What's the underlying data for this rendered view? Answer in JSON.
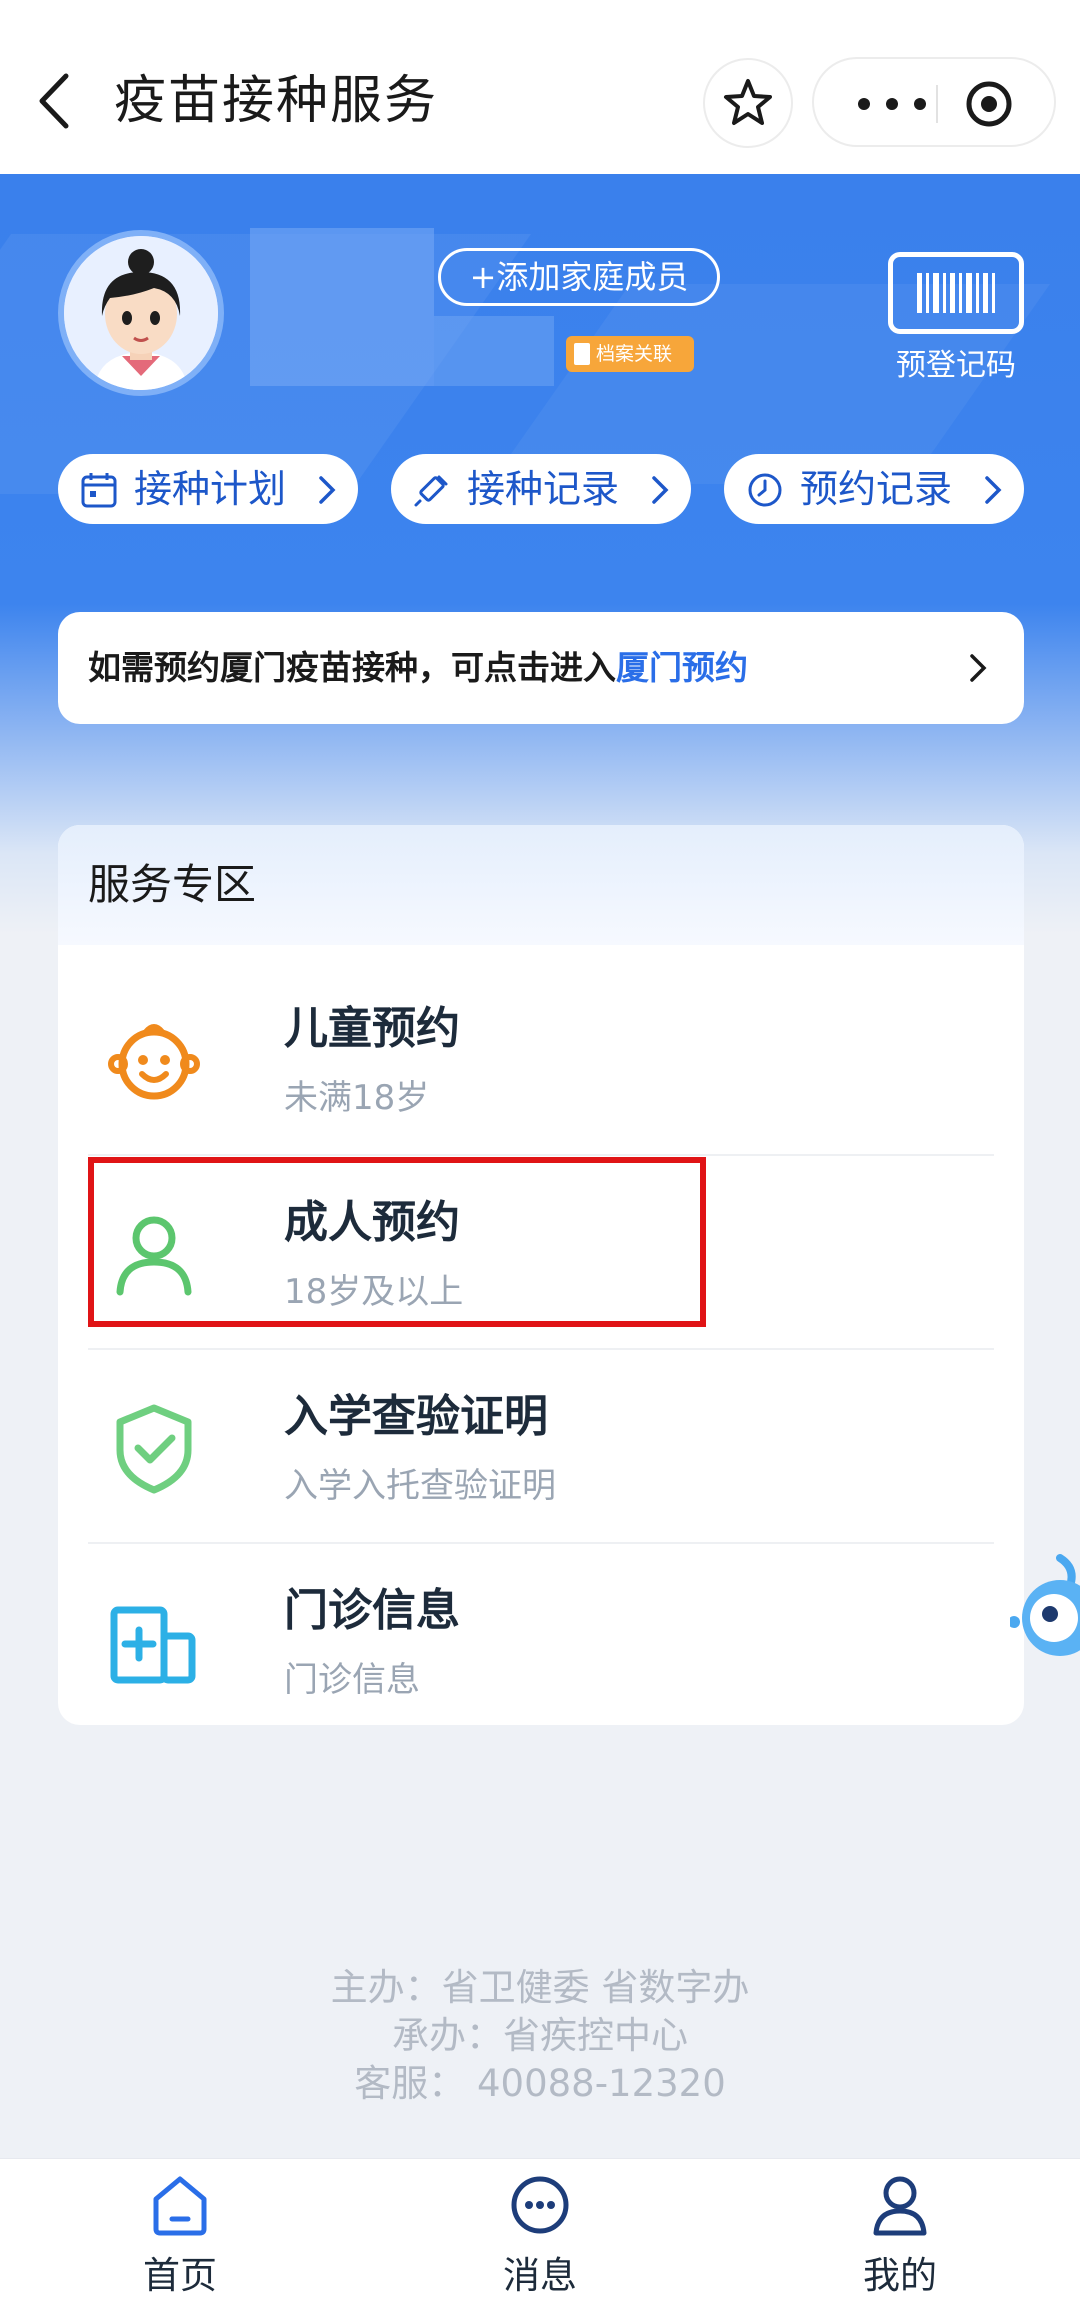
{
  "header": {
    "title": "疫苗接种服务"
  },
  "profile": {
    "add_family_label": "+添加家庭成员",
    "file_badge_label": "档案关联",
    "qr_label": "预登记码"
  },
  "quick_links": [
    {
      "label": "接种计划",
      "icon": "calendar-icon"
    },
    {
      "label": "接种记录",
      "icon": "vaccine-icon"
    },
    {
      "label": "预约记录",
      "icon": "clock-icon"
    }
  ],
  "notice": {
    "text": "如需预约厦门疫苗接种，可点击进入",
    "link": "厦门预约"
  },
  "service": {
    "title": "服务专区",
    "items": [
      {
        "title": "儿童预约",
        "subtitle": "未满18岁",
        "icon": "child-face-icon"
      },
      {
        "title": "成人预约",
        "subtitle": "18岁及以上",
        "icon": "adult-person-icon"
      },
      {
        "title": "入学查验证明",
        "subtitle": "入学入托查验证明",
        "icon": "shield-check-icon"
      },
      {
        "title": "门诊信息",
        "subtitle": "门诊信息",
        "icon": "clinic-icon"
      }
    ]
  },
  "footer": {
    "sponsor": "主办：省卫健委 省数字办",
    "organizer": "承办：省疾控中心",
    "service": "客服：  40088-12320"
  },
  "nav": [
    {
      "label": "首页",
      "icon": "home-icon"
    },
    {
      "label": "消息",
      "icon": "message-icon"
    },
    {
      "label": "我的",
      "icon": "user-icon"
    }
  ],
  "colors": {
    "primary": "#3a80ec",
    "link": "#2a6ee8",
    "highlight": "#e01416"
  }
}
